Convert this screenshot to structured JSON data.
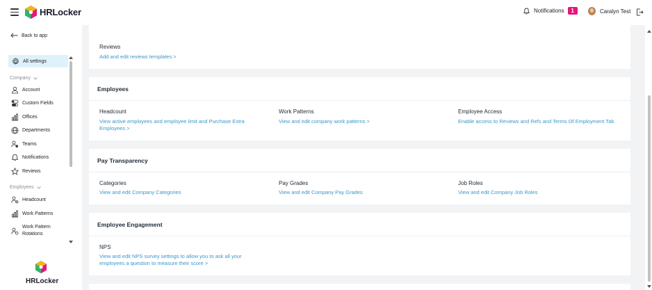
{
  "app": {
    "name": "HRLocker"
  },
  "header": {
    "notifications_label": "Notifications",
    "notifications_count": "1",
    "user_name": "Caralyn Test"
  },
  "sidebar": {
    "back_label": "Back to app",
    "all_settings_label": "All settings",
    "groups": {
      "company": "Company",
      "employees": "Employees"
    },
    "company_items": [
      "Account",
      "Custom Fields",
      "Offices",
      "Departments",
      "Teams",
      "Notifications",
      "Reviews"
    ],
    "employee_items": [
      "Headcount",
      "Work Patterns",
      "Work Pattern Rotations"
    ],
    "logo_text": "HRLocker"
  },
  "main": {
    "reviews": {
      "title": "Reviews",
      "link": "Add and edit reviews templates >"
    },
    "employees": {
      "title": "Employees",
      "items": [
        {
          "title": "Headcount",
          "link": "View active employees and employee limit and Purchase Extra Employees >"
        },
        {
          "title": "Work Patterns",
          "link": "View and edit company work patterns >"
        },
        {
          "title": "Employee Access",
          "link": "Enable access to Reviews and Refs and Terms Of Employment Tab"
        }
      ]
    },
    "pay_transparency": {
      "title": "Pay Transparency",
      "items": [
        {
          "title": "Categories",
          "link": "View and edit Company Categories"
        },
        {
          "title": "Pay Grades",
          "link": "View and edit Company Pay Grades"
        },
        {
          "title": "Job Roles",
          "link": "View and edit Company Job Roles"
        }
      ]
    },
    "engagement": {
      "title": "Employee Engagement",
      "items": [
        {
          "title": "NPS",
          "link": "View and edit NPS survey settings to allow you to ask all your employees a question to measure their score >"
        }
      ]
    }
  },
  "colors": {
    "accent_link": "#3a97c9",
    "badge": "#e6177a",
    "active_bg": "#dff1fb"
  }
}
